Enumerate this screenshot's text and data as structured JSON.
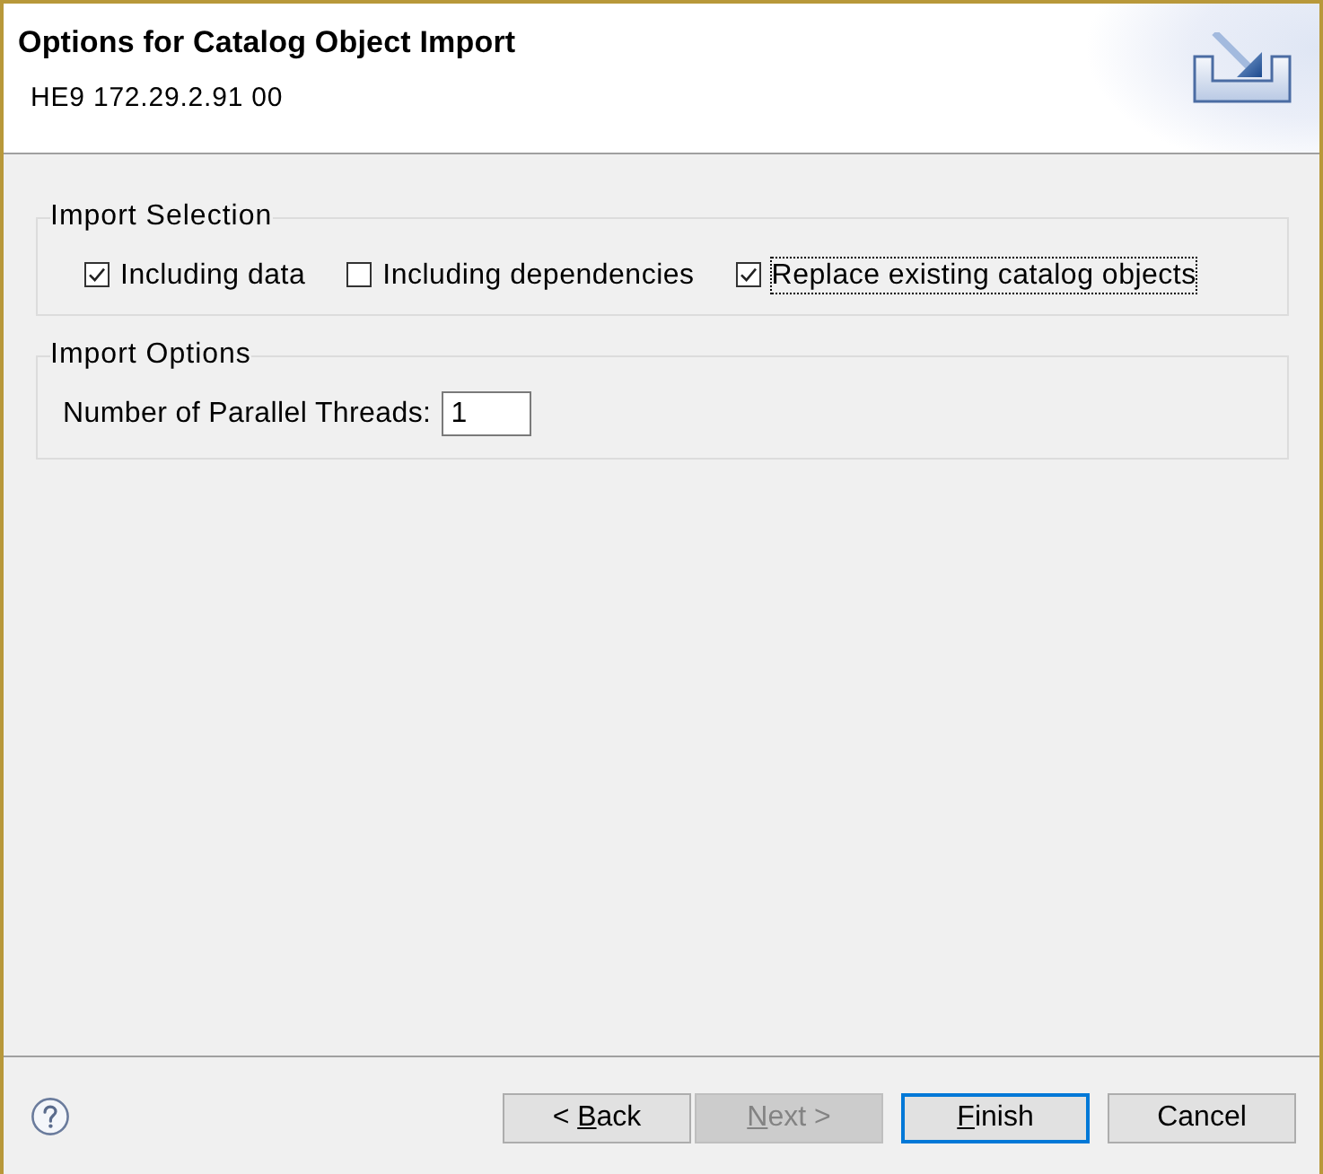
{
  "header": {
    "title": "Options for Catalog Object Import",
    "subtitle": "HE9 172.29.2.91 00"
  },
  "groups": [
    {
      "kind": "checkboxes",
      "legend": "Import Selection",
      "items": [
        {
          "label": "Including data",
          "checked": true,
          "focused": false
        },
        {
          "label": "Including dependencies",
          "checked": false,
          "focused": false
        },
        {
          "label": "Replace existing catalog objects",
          "checked": true,
          "focused": true
        }
      ]
    },
    {
      "kind": "fields",
      "legend": "Import Options",
      "fields": [
        {
          "label": "Number of Parallel Threads:",
          "value": "1"
        }
      ]
    }
  ],
  "footer": {
    "buttons": [
      {
        "label": "< Back",
        "access_key_underlined": true,
        "disabled": false,
        "default": false
      },
      {
        "label": "Next >",
        "access_key_underlined": true,
        "disabled": true,
        "default": false
      },
      {
        "label": "Finish",
        "access_key_underlined": true,
        "disabled": false,
        "default": true
      },
      {
        "label": "Cancel",
        "access_key_underlined": false,
        "disabled": false,
        "default": false
      }
    ]
  }
}
